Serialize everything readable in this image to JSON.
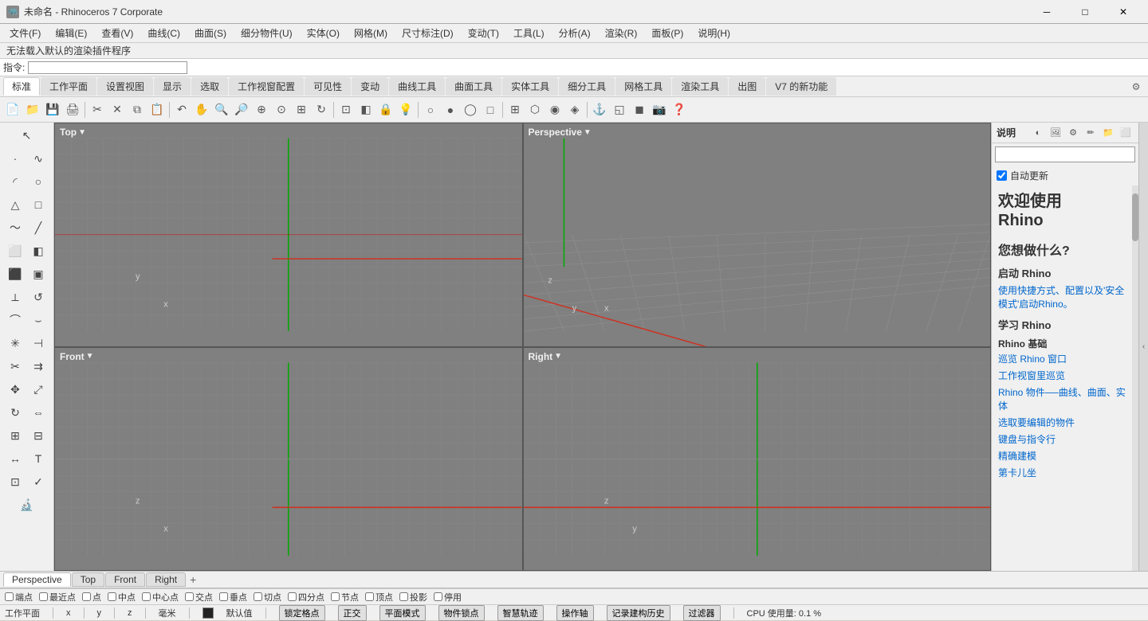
{
  "titlebar": {
    "title": "未命名 - Rhinoceros 7 Corporate",
    "icon": "🦏",
    "minimize_label": "─",
    "maximize_label": "□",
    "close_label": "✕"
  },
  "menubar": {
    "items": [
      {
        "label": "文件(F)"
      },
      {
        "label": "编辑(E)"
      },
      {
        "label": "查看(V)"
      },
      {
        "label": "曲线(C)"
      },
      {
        "label": "曲面(S)"
      },
      {
        "label": "细分物件(U)"
      },
      {
        "label": "实体(O)"
      },
      {
        "label": "网格(M)"
      },
      {
        "label": "尺寸标注(D)"
      },
      {
        "label": "变动(T)"
      },
      {
        "label": "工具(L)"
      },
      {
        "label": "分析(A)"
      },
      {
        "label": "渲染(R)"
      },
      {
        "label": "面板(P)"
      },
      {
        "label": "说明(H)"
      }
    ]
  },
  "infobar": {
    "message": "无法载入默认的渲染插件程序"
  },
  "cmdbar": {
    "label": "指令:",
    "placeholder": ""
  },
  "toolbar_tabs": {
    "tabs": [
      {
        "label": "标准",
        "active": true
      },
      {
        "label": "工作平面"
      },
      {
        "label": "设置视图"
      },
      {
        "label": "显示"
      },
      {
        "label": "选取"
      },
      {
        "label": "工作视窗配置"
      },
      {
        "label": "可见性"
      },
      {
        "label": "变动"
      },
      {
        "label": "曲线工具"
      },
      {
        "label": "曲面工具"
      },
      {
        "label": "实体工具"
      },
      {
        "label": "细分工具"
      },
      {
        "label": "网格工具"
      },
      {
        "label": "渲染工具"
      },
      {
        "label": "出图"
      },
      {
        "label": "V7 的新功能"
      }
    ],
    "settings_icon": "⚙"
  },
  "viewports": {
    "top": {
      "label": "Top",
      "arrow": "▼"
    },
    "perspective": {
      "label": "Perspective",
      "arrow": "▼"
    },
    "front": {
      "label": "Front",
      "arrow": "▼"
    },
    "right": {
      "label": "Right",
      "arrow": "▼"
    }
  },
  "viewport_tabs": {
    "tabs": [
      {
        "label": "Perspective",
        "active": true
      },
      {
        "label": "Top"
      },
      {
        "label": "Front"
      },
      {
        "label": "Right"
      }
    ],
    "add_label": "+"
  },
  "right_panel": {
    "title": "说明",
    "autoupdate_label": "✓自动更新",
    "welcome_title": "欢迎使用\nRhino",
    "what_label": "您想做什么?",
    "launch_rhino": "启动 Rhino",
    "launch_link1": "使用快捷方式、配置以及'安全模式'启动Rhino。",
    "learn_rhino": "学习 Rhino",
    "rhino_basics": "Rhino 基础",
    "link1": "巡览 Rhino 窗口",
    "link2": "工作视窗里巡览",
    "link3": "Rhino 物件──曲线、曲面、实体",
    "link4": "选取要编辑的物件",
    "link5": "键盘与指令行",
    "link6": "精确建模",
    "link7": "第卡儿坐"
  },
  "snapbar": {
    "items": [
      {
        "label": "端点",
        "checked": false
      },
      {
        "label": "最近点",
        "checked": false
      },
      {
        "label": "点",
        "checked": false
      },
      {
        "label": "中点",
        "checked": false
      },
      {
        "label": "中心点",
        "checked": false
      },
      {
        "label": "交点",
        "checked": false
      },
      {
        "label": "垂点",
        "checked": false
      },
      {
        "label": "切点",
        "checked": false
      },
      {
        "label": "四分点",
        "checked": false
      },
      {
        "label": "节点",
        "checked": false
      },
      {
        "label": "顶点",
        "checked": false
      },
      {
        "label": "投影",
        "checked": false
      },
      {
        "label": "停用",
        "checked": false
      }
    ]
  },
  "statusbar": {
    "workspace_label": "工作平面",
    "x_label": "x",
    "y_label": "y",
    "z_label": "z",
    "unit_label": "毫米",
    "color_label": "默认值",
    "snap_label": "锁定格点",
    "ortho_label": "正交",
    "planar_label": "平面模式",
    "osnap_label": "物件锁点",
    "smarttrack_label": "智慧轨迹",
    "gumball_label": "操作轴",
    "history_label": "记录建构历史",
    "filter_label": "过滤器",
    "cpu_label": "CPU 使用量: 0.1 %"
  }
}
